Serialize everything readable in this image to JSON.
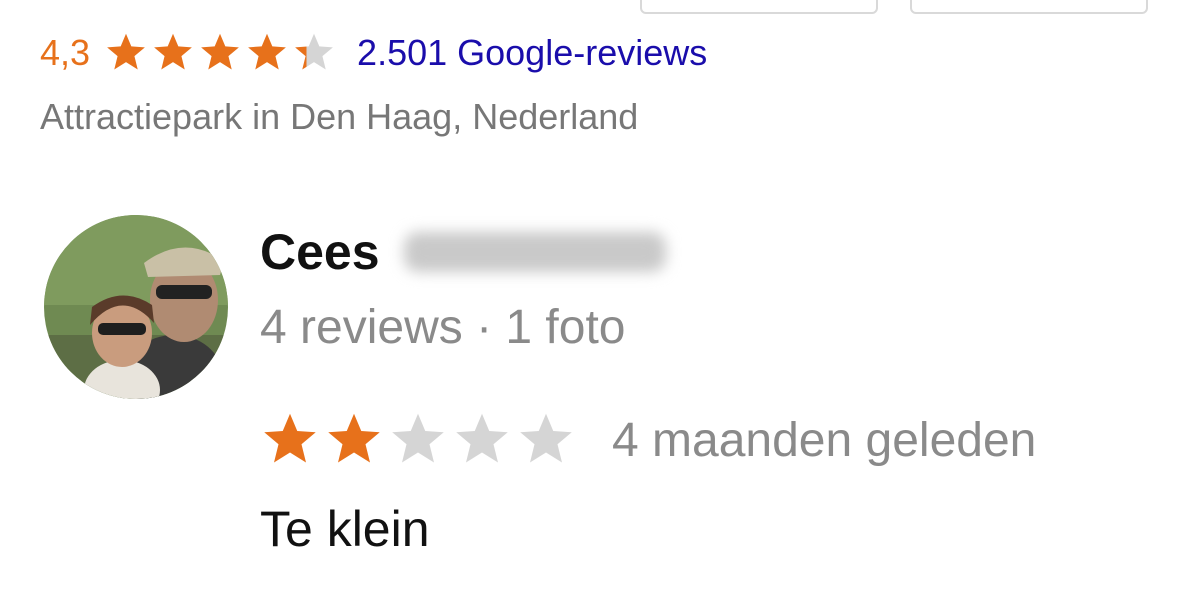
{
  "place": {
    "rating": "4,3",
    "rating_stars": 4.3,
    "review_count_label": "2.501 Google-reviews",
    "subtitle": "Attractiepark in Den Haag, Nederland"
  },
  "review": {
    "reviewer_name": "Cees",
    "reviewer_stats": "4 reviews · 1 foto",
    "stars": 2,
    "stars_max": 5,
    "time_ago": "4 maanden geleden",
    "text": "Te klein"
  },
  "colors": {
    "star_filled": "#e7711b",
    "star_empty": "#d5d5d5",
    "link": "#1a0dab",
    "muted": "#777777"
  }
}
